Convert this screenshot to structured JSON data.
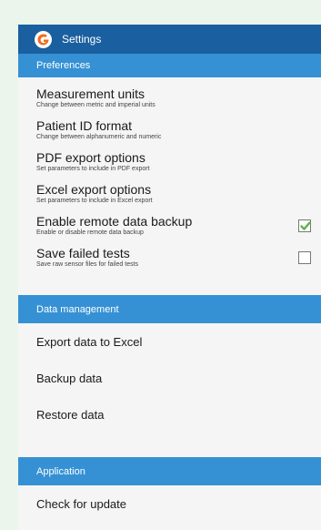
{
  "appbar": {
    "title": "Settings",
    "icon": "app-logo-icon"
  },
  "colors": {
    "appbar": "#1a5f9f",
    "section_header": "#3591d4",
    "check": "#5cb346",
    "logo": "#f06a1e"
  },
  "sections": {
    "preferences": {
      "header": "Preferences",
      "items": [
        {
          "title": "Measurement units",
          "subtitle": "Change between metric and imperial units"
        },
        {
          "title": "Patient ID format",
          "subtitle": "Change between alphanumeric and numeric"
        },
        {
          "title": "PDF export options",
          "subtitle": "Set parameters to include in PDF export"
        },
        {
          "title": "Excel export options",
          "subtitle": "Set parameters to include in Excel export"
        },
        {
          "title": "Enable remote data backup",
          "subtitle": "Enable or disable remote data backup",
          "checked": true
        },
        {
          "title": "Save failed tests",
          "subtitle": "Save raw sensor files for failed tests",
          "checked": false
        }
      ]
    },
    "data_management": {
      "header": "Data management",
      "items": [
        {
          "title": "Export data to Excel"
        },
        {
          "title": "Backup data"
        },
        {
          "title": "Restore data"
        }
      ]
    },
    "application": {
      "header": "Application",
      "items": [
        {
          "title": "Check for update"
        }
      ]
    }
  }
}
